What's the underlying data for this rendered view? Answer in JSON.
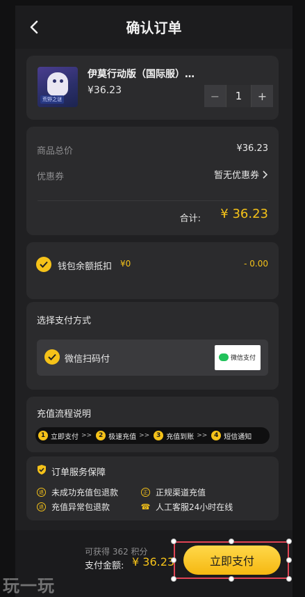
{
  "header": {
    "title": "确认订单",
    "back_icon": "chevron-left-icon"
  },
  "product": {
    "name": "伊莫行动版（国际服）…",
    "price": "¥36.23",
    "thumb_tag": "荒野之谜",
    "quantity": "1",
    "minus": "−",
    "plus": "+"
  },
  "summary": {
    "total_label": "商品总价",
    "total_value": "¥36.23",
    "coupon_label": "优惠券",
    "coupon_value": "暂无优惠券",
    "sum_label": "合计:",
    "sum_value": "¥ 36.23"
  },
  "wallet": {
    "label": "钱包余额抵扣",
    "balance": "¥0",
    "deduct": "- 0.00"
  },
  "payment": {
    "section_title": "选择支付方式",
    "method": "微信扫码付",
    "logo_text": "微信支付"
  },
  "flow": {
    "title": "充值流程说明",
    "steps": [
      {
        "num": "1",
        "label": "立即支付"
      },
      {
        "num": "2",
        "label": "极速充值"
      },
      {
        "num": "3",
        "label": "充值到账"
      },
      {
        "num": "4",
        "label": "短信通知"
      }
    ],
    "arrow": ">>"
  },
  "service": {
    "title": "订单服务保障",
    "items": [
      {
        "icon_text": "退",
        "label": "未成功充值包退款"
      },
      {
        "icon_text": "正",
        "label": "正规渠道充值"
      },
      {
        "icon_text": "退",
        "label": "充值异常包退款"
      },
      {
        "icon_text": "☎",
        "label": "人工客服24小时在线"
      }
    ]
  },
  "footer": {
    "points": "可获得 362 积分",
    "pay_label": "支付金额:",
    "pay_amount": "¥ 36.23",
    "pay_button": "立即支付"
  },
  "watermark": "玩一玩",
  "colors": {
    "accent": "#f5c219",
    "background": "#111112",
    "card": "#2b2b2d",
    "selection": "#e04455"
  }
}
